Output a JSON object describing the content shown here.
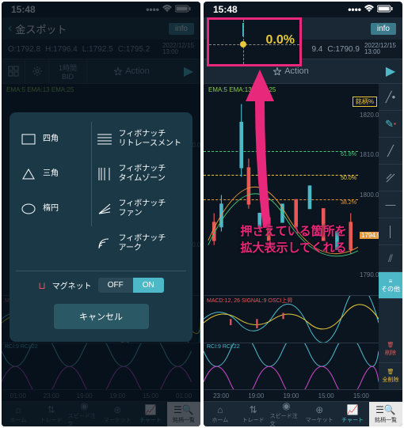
{
  "statusbar": {
    "time": "15:48"
  },
  "header": {
    "title": "金スポット",
    "info": "info"
  },
  "ohlc_left": {
    "o": "O:1792.8",
    "h": "H:1796.4",
    "l": "L:1792.5",
    "c": "C:1795.2",
    "date": "2022/12/15\n13:00"
  },
  "ohlc_right": {
    "partial": "9.4",
    "c": "C:1790.9",
    "date": "2022/12/15\n13:00"
  },
  "toolbar": {
    "time_val": "1時間",
    "time_mode": "BID",
    "action": "Action"
  },
  "ema": {
    "label": "EMA:5 EMA:13 EMA:25"
  },
  "modal": {
    "items": [
      {
        "icon": "rect",
        "label": "四角"
      },
      {
        "icon": "fibret",
        "label": "フィボナッチ\nリトレースメント"
      },
      {
        "icon": "tri",
        "label": "三角"
      },
      {
        "icon": "fibtz",
        "label": "フィボナッチ\nタイムゾーン"
      },
      {
        "icon": "ellipse",
        "label": "楕円"
      },
      {
        "icon": "fibfan",
        "label": "フィボナッチ\nファン"
      },
      {
        "icon": "",
        "label": ""
      },
      {
        "icon": "fibarc",
        "label": "フィボナッチ\nアーク"
      }
    ],
    "magnet": "マグネット",
    "off": "OFF",
    "on": "ON",
    "cancel": "キャンセル"
  },
  "tabs": {
    "home": "ホーム",
    "trade": "トレード",
    "speed": "スピード注文",
    "market": "マーケット",
    "chart": "チャート",
    "list": "銘柄一覧"
  },
  "sidebar": {
    "other": "その他",
    "delete": "削除",
    "delall": "全削除"
  },
  "magnify": {
    "pct": "0.0%"
  },
  "annotation": {
    "line1": "押さえている箇所を",
    "line2": "拡大表示してくれる"
  },
  "chart_data": {
    "yticks_left": [
      "1820.0",
      "1800.0"
    ],
    "yticks_right": [
      "1820.0",
      "1810.0",
      "1800.0",
      "1794.9",
      "1790.0"
    ],
    "fib_levels": [
      {
        "pct": "61.8%",
        "color": "#48c878"
      },
      {
        "pct": "50.0%",
        "color": "#e8c838"
      },
      {
        "pct": "38.2%",
        "color": "#e89838"
      }
    ],
    "xticks": [
      "01:00",
      "23:00",
      "19:00",
      "19:00",
      "15:00",
      "01:00"
    ],
    "xticks_r": [
      "23:00",
      "19:00",
      "19:00",
      "15:00",
      "15:00"
    ],
    "macd_label": "MACD:12, 26 SIGNAL:9 OSCI上昇",
    "rci_label": "RCI:9 RCI:22",
    "price_box": "銘柄%"
  }
}
